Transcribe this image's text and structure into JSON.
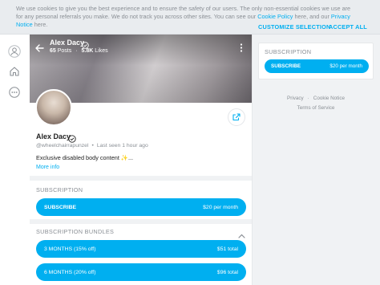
{
  "cookie": {
    "text_line1": "We use cookies to give you the best experience and to ensure the safety of our users. The only non-essential cookies we use are for any personal",
    "text_line2a": "referrals you make. We do not track you across other sites. You can see our ",
    "cookie_policy": "Cookie Policy",
    "text_line2b": " here, and our ",
    "privacy_notice": "Privacy Notice",
    "text_line2c": " here.",
    "customize_label": "CUSTOMIZE SELECTION",
    "accept_label": "ACCEPT ALL"
  },
  "cover": {
    "name": "Alex Dacy",
    "posts_count": "65",
    "posts_label": "Posts",
    "likes_count": "5.8K",
    "likes_label": "Likes"
  },
  "profile": {
    "name": "Alex Dacy",
    "handle": "@wheelchairrapunzel",
    "last_seen": "Last seen 1 hour ago",
    "bio": "Exclusive disabled body content ✨...",
    "more_info": "More info"
  },
  "subscription": {
    "title": "SUBSCRIPTION",
    "button_label": "SUBSCRIBE",
    "button_price": "$20 per month"
  },
  "bundles": {
    "title": "SUBSCRIPTION BUNDLES",
    "items": [
      {
        "label": "3 MONTHS (15% off)",
        "price": "$51 total"
      },
      {
        "label": "6 MONTHS (20% off)",
        "price": "$96 total"
      }
    ]
  },
  "right_panel": {
    "title": "SUBSCRIPTION",
    "button_label": "SUBSCRIBE",
    "button_price": "$20 per month"
  },
  "footer": {
    "privacy": "Privacy",
    "cookie_notice": "Cookie Notice",
    "terms": "Terms of Service"
  },
  "colors": {
    "accent": "#00aff0",
    "muted": "#8a8f95",
    "background": "#f0f2f4"
  },
  "icons": {
    "sidebar": [
      "user-icon",
      "home-icon",
      "more-circle-icon"
    ],
    "cover": [
      "back-arrow-icon",
      "verified-icon",
      "more-vertical-icon"
    ],
    "profile": [
      "share-icon",
      "verified-icon",
      "chevron-up-icon"
    ]
  }
}
